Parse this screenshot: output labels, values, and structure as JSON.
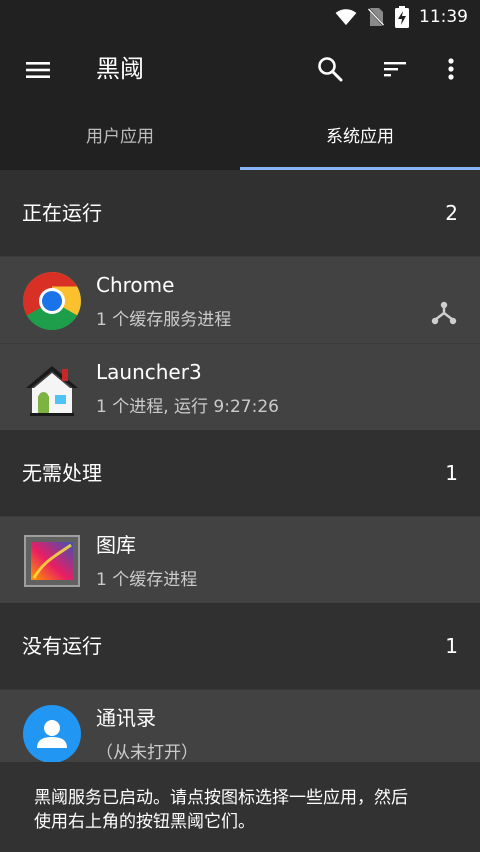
{
  "status_bar": {
    "time": "11:39",
    "icons": [
      "wifi-icon",
      "no-sim-icon",
      "battery-charging-icon"
    ]
  },
  "app_bar": {
    "title": "黑阈",
    "icons": [
      "menu-icon",
      "search-icon",
      "sort-icon",
      "more-vert-icon"
    ]
  },
  "tabs": [
    {
      "label": "用户应用",
      "active": false
    },
    {
      "label": "系统应用",
      "active": true
    }
  ],
  "sections": [
    {
      "title": "正在运行",
      "count": "2",
      "items": [
        {
          "name": "Chrome",
          "sub": "1 个缓存服务进程",
          "icon": "chrome-icon",
          "action_icon": "fork-icon"
        },
        {
          "name": "Launcher3",
          "sub": "1 个进程, 运行 9:27:26",
          "icon": "launcher-house-icon"
        }
      ]
    },
    {
      "title": "无需处理",
      "count": "1",
      "items": [
        {
          "name": "图库",
          "sub": "1 个缓存进程",
          "icon": "gallery-icon"
        }
      ]
    },
    {
      "title": "没有运行",
      "count": "1",
      "items": [
        {
          "name": "通讯录",
          "sub": "（从未打开）",
          "icon": "contacts-icon"
        }
      ]
    }
  ],
  "snackbar": {
    "line1": "黑阈服务已启动。请点按图标选择一些应用，然后",
    "line2": "使用右上角的按钮黑阈它们。"
  },
  "colors": {
    "tab_indicator": "#8ab4f8",
    "background": "#303030",
    "app_bar": "#212121",
    "list_item": "#424242"
  }
}
